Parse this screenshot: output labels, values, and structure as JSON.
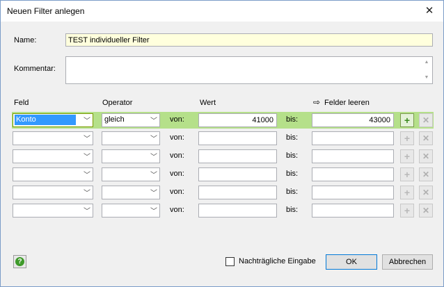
{
  "window": {
    "title": "Neuen Filter anlegen",
    "close_glyph": "✕"
  },
  "form": {
    "name_label": "Name:",
    "name_value": "TEST individueller Filter",
    "comment_label": "Kommentar:",
    "comment_value": ""
  },
  "headers": {
    "feld": "Feld",
    "operator": "Operator",
    "wert": "Wert",
    "clear": "Felder leeren",
    "clear_icon": "⇨"
  },
  "row_labels": {
    "von": "von:",
    "bis": "bis:"
  },
  "rows": [
    {
      "feld": "Konto",
      "operator": "gleich",
      "von": "41000",
      "bis": "43000"
    },
    {
      "feld": "",
      "operator": "",
      "von": "",
      "bis": ""
    },
    {
      "feld": "",
      "operator": "",
      "von": "",
      "bis": ""
    },
    {
      "feld": "",
      "operator": "",
      "von": "",
      "bis": ""
    },
    {
      "feld": "",
      "operator": "",
      "von": "",
      "bis": ""
    },
    {
      "feld": "",
      "operator": "",
      "von": "",
      "bis": ""
    }
  ],
  "icons": {
    "add": "plus-icon",
    "delete": "delete-icon",
    "help": "help-icon",
    "dropdown": "chevron-down-icon"
  },
  "footer": {
    "checkbox_label": "Nachträgliche Eingabe",
    "checkbox_checked": false,
    "ok_label": "OK",
    "cancel_label": "Abbrechen"
  },
  "colors": {
    "active_row": "#b5e08a",
    "name_field_bg": "#ffffdd",
    "selection": "#3399ff"
  }
}
